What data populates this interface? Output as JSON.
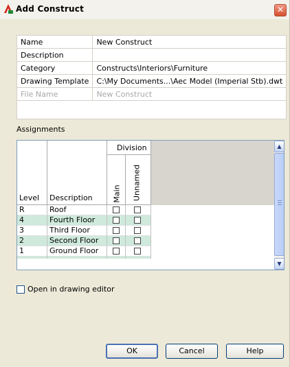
{
  "window": {
    "title": "Add Construct",
    "close_glyph": "✕",
    "icon": "autocad-a-icon"
  },
  "properties": [
    {
      "key": "Name",
      "value": "New Construct",
      "disabled": false
    },
    {
      "key": "Description",
      "value": "",
      "disabled": false
    },
    {
      "key": "Category",
      "value": "Constructs\\Interiors\\Furniture",
      "disabled": false
    },
    {
      "key": "Drawing Template",
      "value": "C:\\My Documents...\\Aec Model (Imperial Stb).dwt",
      "disabled": false
    },
    {
      "key": "File Name",
      "value": "New Construct",
      "disabled": true
    }
  ],
  "assignments": {
    "label": "Assignments",
    "headers": {
      "level": "Level",
      "description": "Description",
      "division": "Division",
      "divisions": [
        "Main",
        "Unnamed"
      ]
    },
    "rows": [
      {
        "level": "R",
        "description": "Roof",
        "main": false,
        "unnamed": false
      },
      {
        "level": "4",
        "description": "Fourth Floor",
        "main": false,
        "unnamed": false
      },
      {
        "level": "3",
        "description": "Third Floor",
        "main": false,
        "unnamed": false
      },
      {
        "level": "2",
        "description": "Second Floor",
        "main": false,
        "unnamed": false
      },
      {
        "level": "1",
        "description": "Ground Floor",
        "main": false,
        "unnamed": false
      }
    ],
    "scroll_up": "▲",
    "scroll_down": "▼"
  },
  "open_in_editor": {
    "label": "Open in drawing editor",
    "checked": false
  },
  "buttons": {
    "ok": "OK",
    "cancel": "Cancel",
    "help": "Help"
  },
  "colors": {
    "alt_row": "#cfeadd",
    "dialog_bg": "#ece9d8",
    "header_gray": "#d7d5cd"
  }
}
